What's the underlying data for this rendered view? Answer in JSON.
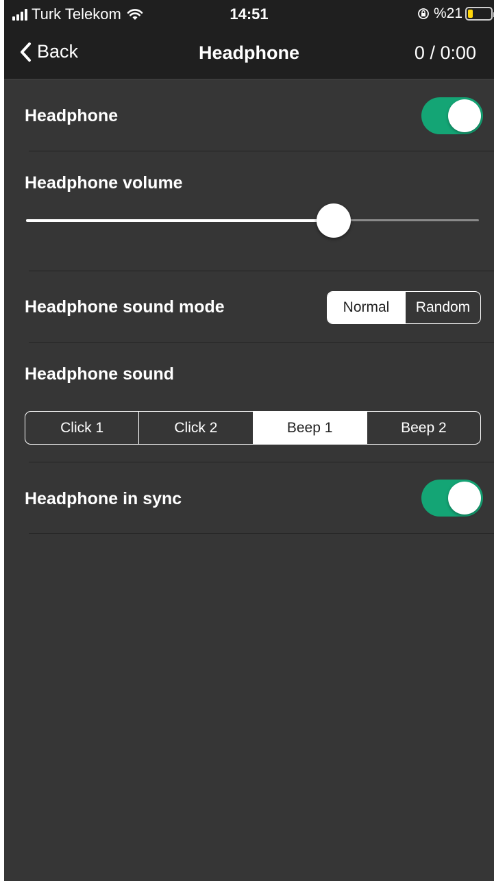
{
  "status_bar": {
    "carrier": "Turk Telekom",
    "time": "14:51",
    "battery_text": "%21",
    "battery_level": 0.21,
    "signal_icon": "signal-bars-icon",
    "wifi_icon": "wifi-icon",
    "lock_icon": "orientation-lock-icon"
  },
  "nav": {
    "back_label": "Back",
    "title": "Headphone",
    "counter": "0 / 0:00"
  },
  "settings": {
    "headphone": {
      "label": "Headphone",
      "on": true
    },
    "volume": {
      "label": "Headphone volume",
      "value": 0.68
    },
    "sound_mode": {
      "label": "Headphone sound mode",
      "options": [
        "Normal",
        "Random"
      ],
      "selected": "Normal"
    },
    "sound": {
      "label": "Headphone sound",
      "options": [
        "Click 1",
        "Click 2",
        "Beep 1",
        "Beep 2"
      ],
      "selected": "Beep 1"
    },
    "in_sync": {
      "label": "Headphone in sync",
      "on": true
    }
  },
  "colors": {
    "background": "#363636",
    "bar": "#1f1f1f",
    "toggle_on": "#14a575",
    "battery_fill": "#ffd60a"
  }
}
